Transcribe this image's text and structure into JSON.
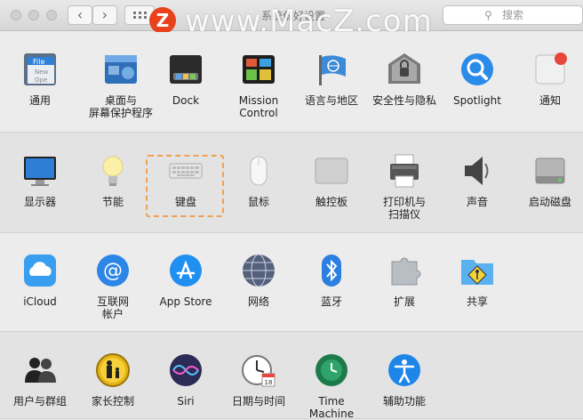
{
  "window": {
    "title": "系统偏好设置",
    "search_placeholder": "搜索",
    "back": "‹",
    "forward": "›"
  },
  "watermark": {
    "logo": "Z",
    "text": "www.MacZ.com"
  },
  "rows": [
    {
      "items": [
        {
          "label": "通用",
          "icon": "general-icon"
        },
        {
          "label": "桌面与\n屏幕保护程序",
          "icon": "desktop-icon"
        },
        {
          "label": "Dock",
          "icon": "dock-icon"
        },
        {
          "label": "Mission\nControl",
          "icon": "mission-control-icon"
        },
        {
          "label": "语言与地区",
          "icon": "language-icon"
        },
        {
          "label": "安全性与隐私",
          "icon": "security-icon"
        },
        {
          "label": "Spotlight",
          "icon": "spotlight-icon"
        },
        {
          "label": "通知",
          "icon": "notifications-icon"
        }
      ]
    },
    {
      "items": [
        {
          "label": "显示器",
          "icon": "display-icon"
        },
        {
          "label": "节能",
          "icon": "energy-icon"
        },
        {
          "label": "键盘",
          "icon": "keyboard-icon"
        },
        {
          "label": "鼠标",
          "icon": "mouse-icon"
        },
        {
          "label": "触控板",
          "icon": "trackpad-icon"
        },
        {
          "label": "打印机与\n扫描仪",
          "icon": "printer-icon"
        },
        {
          "label": "声音",
          "icon": "sound-icon"
        },
        {
          "label": "启动磁盘",
          "icon": "startup-disk-icon"
        }
      ]
    },
    {
      "items": [
        {
          "label": "iCloud",
          "icon": "icloud-icon"
        },
        {
          "label": "互联网\n帐户",
          "icon": "internet-accounts-icon"
        },
        {
          "label": "App Store",
          "icon": "app-store-icon"
        },
        {
          "label": "网络",
          "icon": "network-icon"
        },
        {
          "label": "蓝牙",
          "icon": "bluetooth-icon"
        },
        {
          "label": "扩展",
          "icon": "extensions-icon"
        },
        {
          "label": "共享",
          "icon": "sharing-icon"
        }
      ]
    },
    {
      "items": [
        {
          "label": "用户与群组",
          "icon": "users-icon"
        },
        {
          "label": "家长控制",
          "icon": "parental-controls-icon"
        },
        {
          "label": "Siri",
          "icon": "siri-icon"
        },
        {
          "label": "日期与时间",
          "icon": "date-time-icon"
        },
        {
          "label": "Time Machine",
          "icon": "time-machine-icon"
        },
        {
          "label": "辅助功能",
          "icon": "accessibility-icon"
        }
      ]
    }
  ],
  "highlighted_item": "键盘",
  "colors": {
    "highlight": "#f0a050",
    "row_dark": "#e3e3e3",
    "row_light": "#ececec"
  }
}
